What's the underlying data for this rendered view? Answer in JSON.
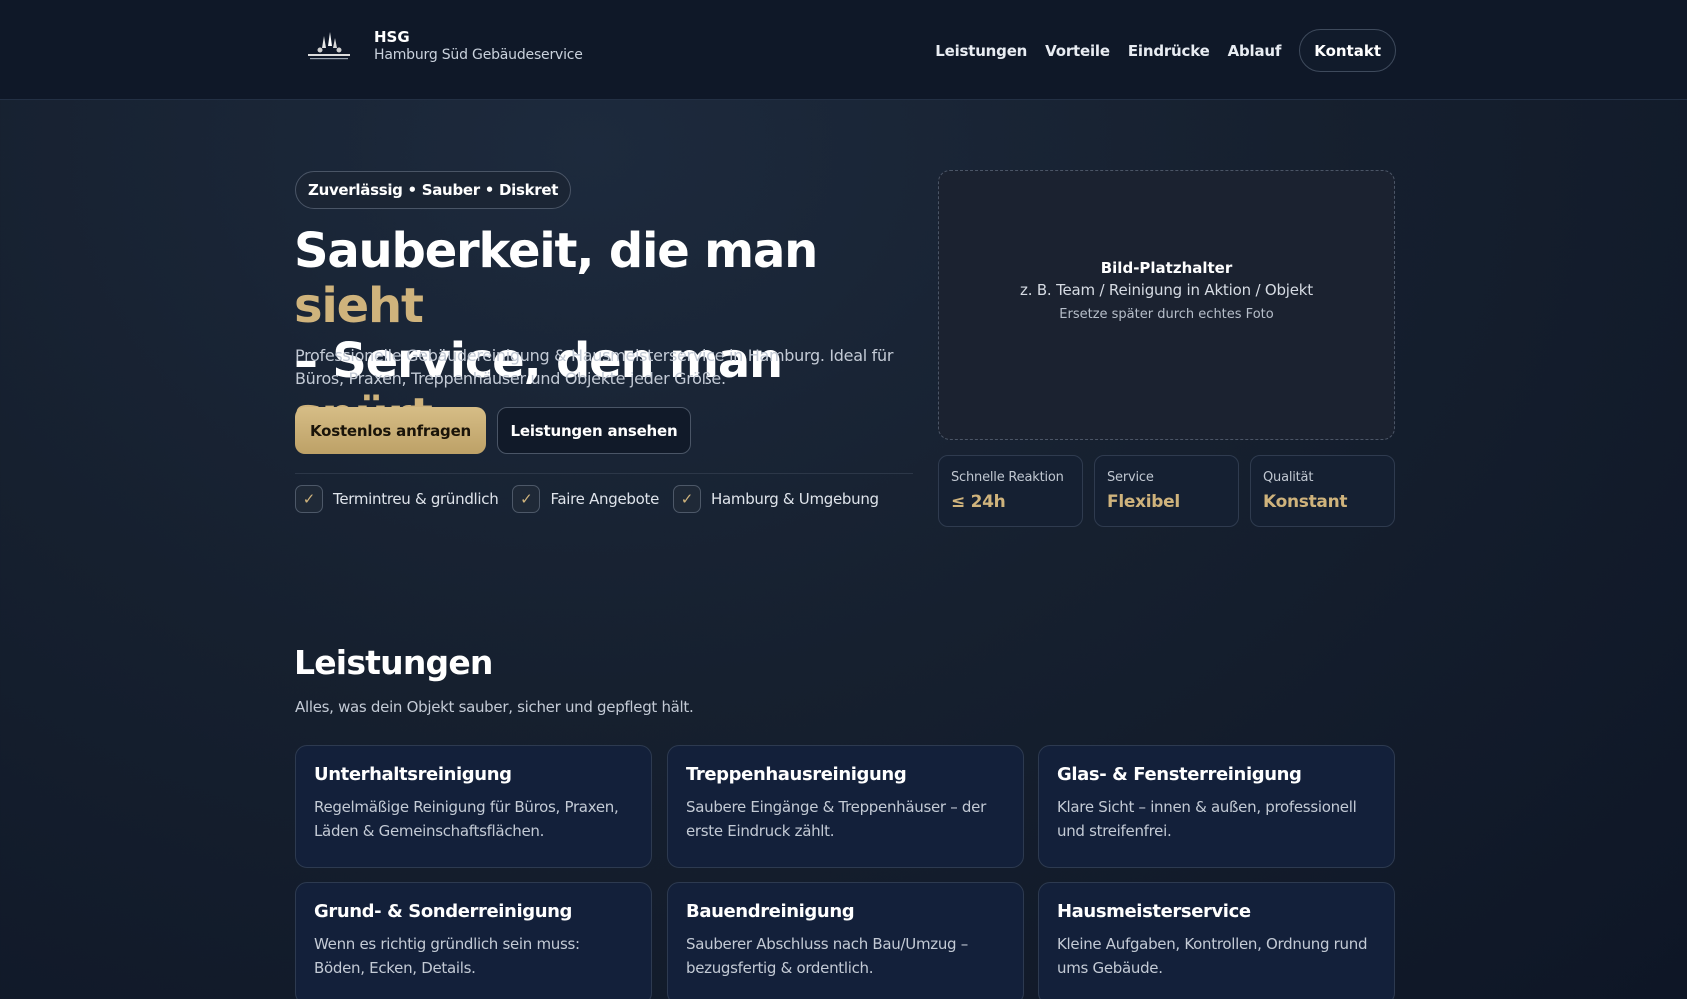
{
  "header": {
    "brand_abbr": "HSG",
    "brand_name": "Hamburg Süd Gebäudeservice",
    "nav": [
      "Leistungen",
      "Vorteile",
      "Eindrücke",
      "Ablauf"
    ],
    "contact_label": "Kontakt"
  },
  "hero": {
    "badge": "Zuverlässig • Sauber • Diskret",
    "headline_part1": "Sauberkeit, die man ",
    "headline_gold1": "sieht",
    "headline_part2": "– Service, den man ",
    "headline_gold2": "spürt",
    "headline_end": ".",
    "lead": "Professionelle Gebäudereinigung & Hausmeisterservice in Hamburg. Ideal für Büros, Praxen, Treppenhäuser und Objekte jeder Größe.",
    "primary_button": "Kostenlos anfragen",
    "secondary_button": "Leistungen ansehen",
    "checks": [
      "Termintreu & gründlich",
      "Faire Angebote",
      "Hamburg & Umgebung"
    ],
    "check_mark": "✓"
  },
  "image_placeholder": {
    "title": "Bild-Platzhalter",
    "subtitle": "z. B. Team / Reinigung in Aktion / Objekt",
    "note": "Ersetze später durch echtes Foto"
  },
  "stats": [
    {
      "label": "Schnelle Reaktion",
      "value": "≤ 24h"
    },
    {
      "label": "Service",
      "value": "Flexibel"
    },
    {
      "label": "Qualität",
      "value": "Konstant"
    }
  ],
  "services": {
    "title": "Leistungen",
    "subtitle": "Alles, was dein Objekt sauber, sicher und gepflegt hält.",
    "cards": [
      {
        "title": "Unterhaltsreinigung",
        "text": "Regelmäßige Reinigung für Büros, Praxen, Läden & Gemeinschaftsflächen."
      },
      {
        "title": "Treppenhausreinigung",
        "text": "Saubere Eingänge & Treppenhäuser – der erste Eindruck zählt."
      },
      {
        "title": "Glas- & Fensterreinigung",
        "text": "Klare Sicht – innen & außen, professionell und streifenfrei."
      },
      {
        "title": "Grund- & Sonderreinigung",
        "text": "Wenn es richtig gründlich sein muss: Böden, Ecken, Details."
      },
      {
        "title": "Bauendreinigung",
        "text": "Sauberer Abschluss nach Bau/Umzug – bezugsfertig & ordentlich."
      },
      {
        "title": "Hausmeisterservice",
        "text": "Kleine Aufgaben, Kontrollen, Ordnung rund ums Gebäude."
      }
    ]
  },
  "colors": {
    "accent_gold": "#cfb37c",
    "background": "#16202f",
    "card": "#13203a"
  }
}
